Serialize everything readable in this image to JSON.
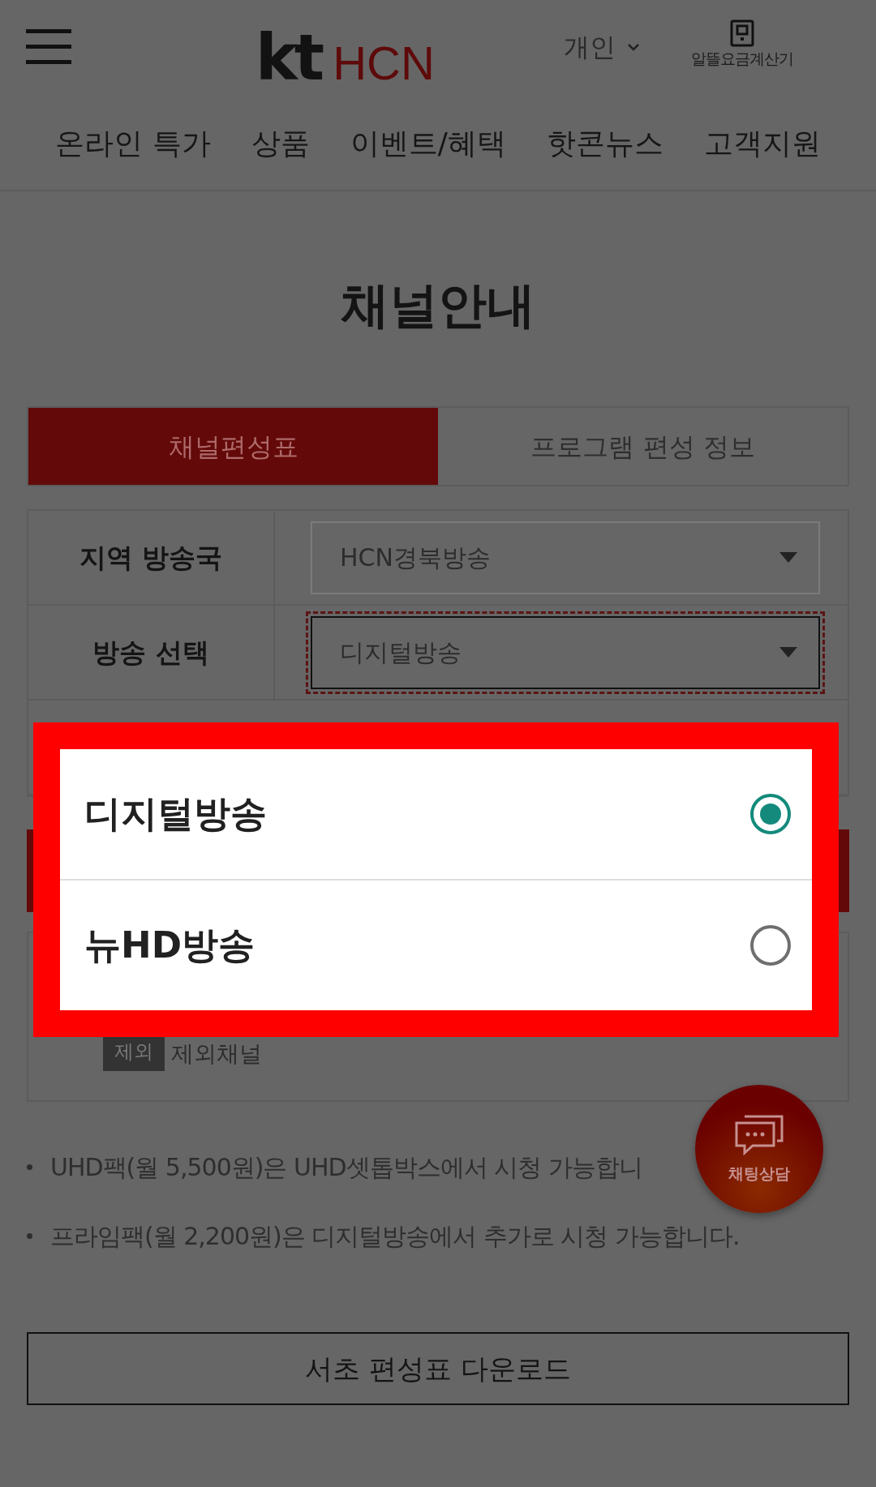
{
  "header": {
    "logo": {
      "brand": "kt",
      "name": "HCN"
    },
    "segment": {
      "label": "개인"
    },
    "calculator": {
      "label": "알뜰요금계산기"
    }
  },
  "nav": {
    "items": [
      "온라인 특가",
      "상품",
      "이벤트/혜택",
      "핫콘뉴스",
      "고객지원"
    ]
  },
  "page_title": "채널안내",
  "tabs": [
    {
      "label": "채널편성표",
      "selected": true
    },
    {
      "label": "프로그램 편성 정보",
      "selected": false
    }
  ],
  "form_rows": [
    {
      "label": "지역 방송국",
      "value": "HCN경북방송",
      "focused": false
    },
    {
      "label": "방송 선택",
      "value": "디지털방송",
      "focused": true
    }
  ],
  "legend": {
    "badge": "제외",
    "label": "제외채널"
  },
  "notes": [
    "UHD팩(월 5,500원)은 UHD셋톱박스에서 시청 가능합니",
    "프라임팩(월 2,200원)은 디지털방송에서 추가로 시청 가능합니다."
  ],
  "download_button": "서초 편성표 다운로드",
  "chat_button": {
    "label": "채팅상담"
  },
  "dialog": {
    "options": [
      {
        "label": "디지털방송",
        "selected": true
      },
      {
        "label": "뉴HD방송",
        "selected": false
      }
    ]
  }
}
